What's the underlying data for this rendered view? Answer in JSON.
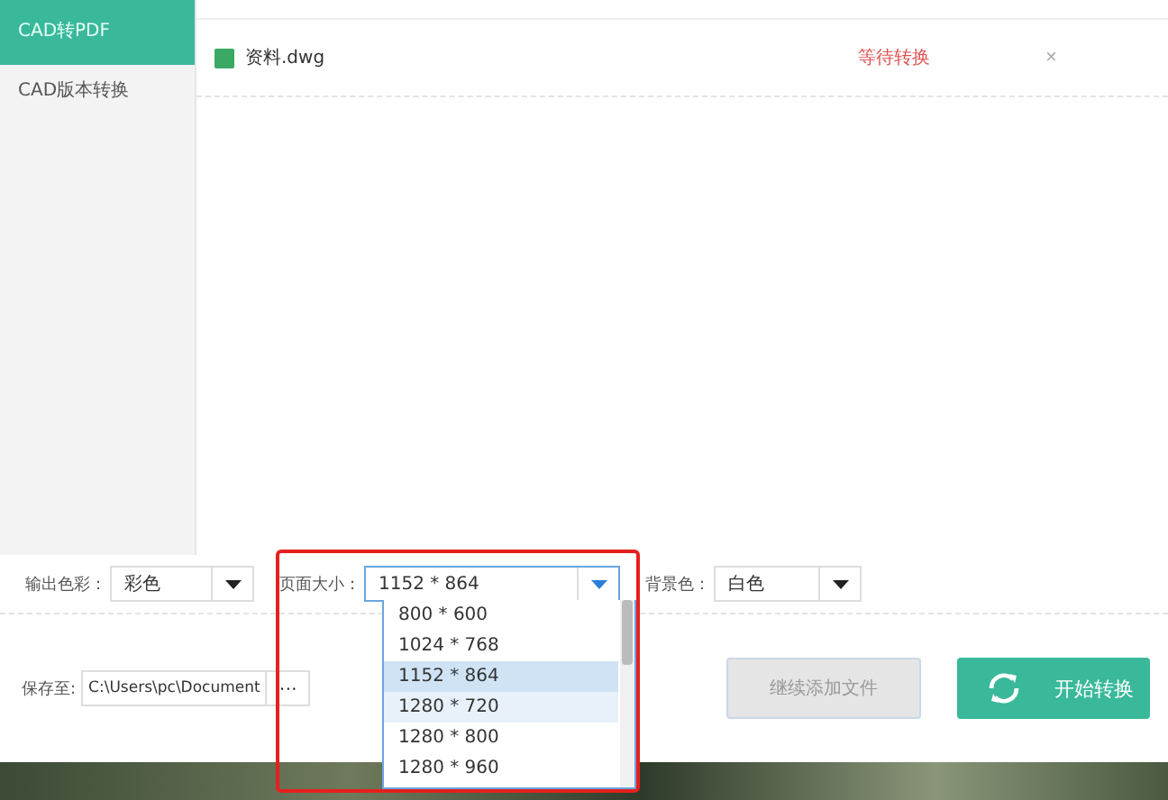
{
  "sidebar": {
    "items": [
      {
        "label": "CAD转PDF",
        "selected": true
      },
      {
        "label": "CAD版本转换",
        "selected": false
      }
    ]
  },
  "files": [
    {
      "name": "资料.dwg",
      "status": "等待转换",
      "delete": "×"
    }
  ],
  "options": [
    {
      "label": "输出色彩：",
      "value": "彩色",
      "open": false
    },
    {
      "label": "页面大小：",
      "value": "1152 * 864",
      "open": true
    },
    {
      "label": "背景色：",
      "value": "白色",
      "open": false
    }
  ],
  "page_size_menu": {
    "items": [
      {
        "label": "800 * 600",
        "selected": false,
        "hovered": false
      },
      {
        "label": "1024 * 768",
        "selected": false,
        "hovered": false
      },
      {
        "label": "1152 * 864",
        "selected": true,
        "hovered": false
      },
      {
        "label": "1280 * 720",
        "selected": false,
        "hovered": true
      },
      {
        "label": "1280 * 800",
        "selected": false,
        "hovered": false
      },
      {
        "label": "1280 * 960",
        "selected": false,
        "hovered": false
      }
    ]
  },
  "save": {
    "label": "保存至:",
    "path": "C:\\Users\\pc\\Document",
    "browse": "···"
  },
  "buttons": {
    "add_files": {
      "label": "继续添加文件",
      "disabled": true
    },
    "start": {
      "label": "开始转换"
    }
  }
}
